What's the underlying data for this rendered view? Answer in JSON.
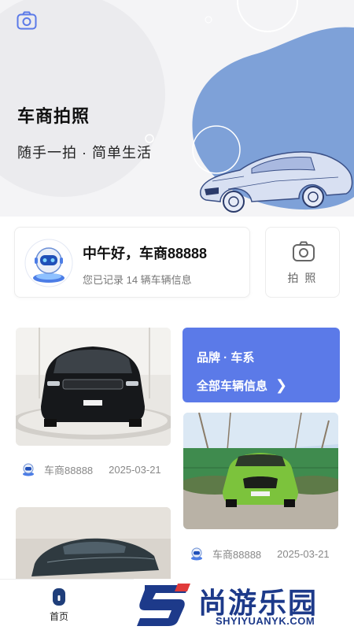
{
  "hero": {
    "title": "车商拍照",
    "subtitle": "随手一拍 · 简单生活"
  },
  "greeting": {
    "name": "中午好，车商88888",
    "info": "您已记录 14 辆车辆信息"
  },
  "photo_button": {
    "label": "拍 照"
  },
  "brand_card": {
    "title": "品牌 · 车系",
    "link": "全部车辆信息",
    "arrow": "❯"
  },
  "cars": [
    {
      "dealer": "车商88888",
      "date": "2025-03-21",
      "image": "black-suv-photo"
    },
    {
      "dealer": "车商88888",
      "date": "2025-03-21",
      "image": "green-suv-photo"
    },
    {
      "image": "dark-sedan-photo"
    }
  ],
  "tabbar": {
    "home_label": "首页"
  },
  "watermark": {
    "cn": "尚游乐园",
    "en": "SHYIYUANYK.COM"
  },
  "colors": {
    "accent": "#5b7ae8",
    "hero_blob": "#7ea1d8",
    "watermark": "#1d3a8a"
  }
}
